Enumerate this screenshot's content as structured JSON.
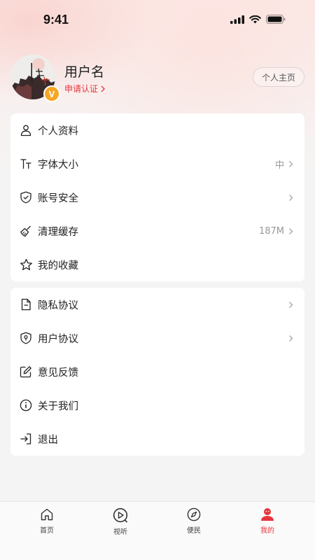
{
  "status_bar": {
    "time": "9:41"
  },
  "profile": {
    "username": "用户名",
    "verify_label": "申请认证",
    "homepage_button": "个人主页",
    "badge": "V"
  },
  "menu_group_1": [
    {
      "icon": "person-icon",
      "label": "个人资料",
      "value": "",
      "arrow": false
    },
    {
      "icon": "font-size-icon",
      "label": "字体大小",
      "value": "中",
      "arrow": true
    },
    {
      "icon": "shield-check-icon",
      "label": "账号安全",
      "value": "",
      "arrow": true
    },
    {
      "icon": "broom-icon",
      "label": "清理缓存",
      "value": "187M",
      "arrow": true
    },
    {
      "icon": "star-icon",
      "label": "我的收藏",
      "value": "",
      "arrow": false
    }
  ],
  "menu_group_2": [
    {
      "icon": "document-icon",
      "label": "隐私协议",
      "value": "",
      "arrow": true
    },
    {
      "icon": "shield-location-icon",
      "label": "用户协议",
      "value": "",
      "arrow": true
    },
    {
      "icon": "edit-icon",
      "label": "意见反馈",
      "value": "",
      "arrow": false
    },
    {
      "icon": "info-icon",
      "label": "关于我们",
      "value": "",
      "arrow": false
    },
    {
      "icon": "logout-icon",
      "label": "退出",
      "value": "",
      "arrow": false
    }
  ],
  "tabbar": [
    {
      "icon": "home-icon",
      "label": "首页",
      "active": false
    },
    {
      "icon": "play-icon",
      "label": "视听",
      "active": false
    },
    {
      "icon": "compass-icon",
      "label": "便民",
      "active": false
    },
    {
      "icon": "user-icon",
      "label": "我的",
      "active": true
    }
  ],
  "colors": {
    "accent": "#e8343b",
    "badge": "#f5a623",
    "background": "#f5f4f4"
  }
}
